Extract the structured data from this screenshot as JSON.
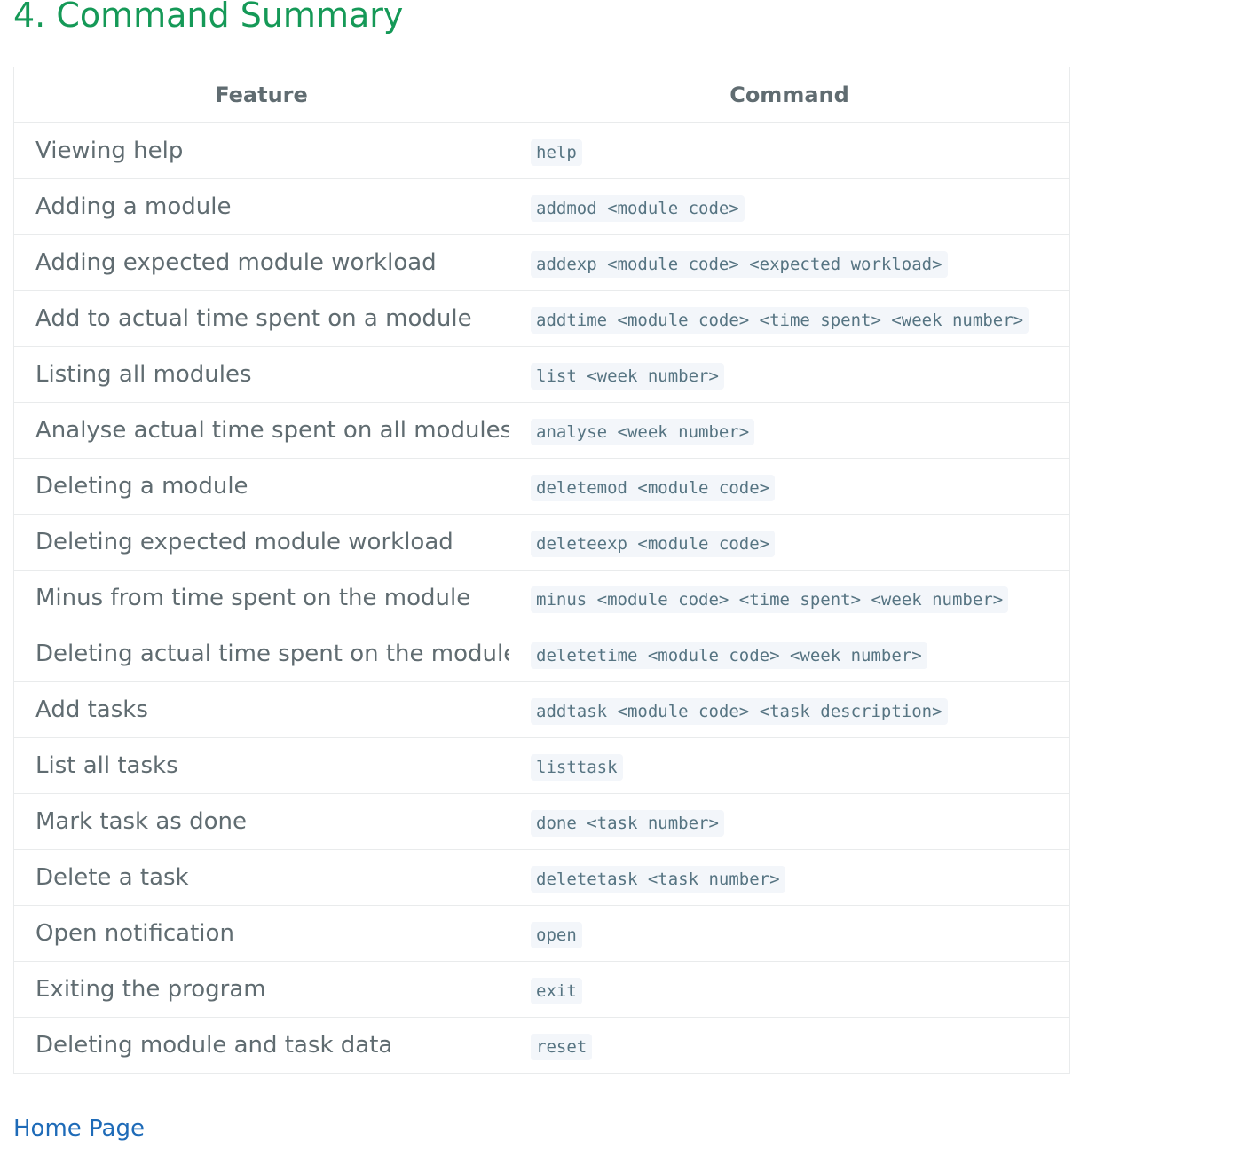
{
  "heading": "4. Command Summary",
  "table": {
    "headers": [
      "Feature",
      "Command"
    ],
    "rows": [
      {
        "feature": "Viewing help",
        "command": "help"
      },
      {
        "feature": "Adding a module",
        "command": "addmod <module code>"
      },
      {
        "feature": "Adding expected module workload",
        "command": "addexp <module code> <expected workload>"
      },
      {
        "feature": "Add to actual time spent on a module",
        "command": "addtime <module code> <time spent> <week number>"
      },
      {
        "feature": "Listing all modules",
        "command": "list <week number>"
      },
      {
        "feature": "Analyse actual time spent on all modules",
        "command": "analyse <week number>"
      },
      {
        "feature": "Deleting a module",
        "command": "deletemod <module code>"
      },
      {
        "feature": "Deleting expected module workload",
        "command": "deleteexp <module code>"
      },
      {
        "feature": "Minus from time spent on the module",
        "command": "minus <module code> <time spent> <week number>"
      },
      {
        "feature": "Deleting actual time spent on the module",
        "command": "deletetime <module code> <week number>"
      },
      {
        "feature": "Add tasks",
        "command": "addtask <module code> <task description>"
      },
      {
        "feature": "List all tasks",
        "command": "listtask"
      },
      {
        "feature": "Mark task as done",
        "command": "done <task number>"
      },
      {
        "feature": "Delete a task",
        "command": "deletetask <task number>"
      },
      {
        "feature": "Open notification",
        "command": "open"
      },
      {
        "feature": "Exiting the program",
        "command": "exit"
      },
      {
        "feature": "Deleting module and task data",
        "command": "reset"
      }
    ]
  },
  "footer": {
    "home_link": "Home Page"
  },
  "colors": {
    "heading": "#159957",
    "text": "#606c71",
    "code_text": "#567482",
    "code_bg": "#f3f6fa",
    "border": "#e9ebec",
    "link": "#1e6bb8"
  }
}
